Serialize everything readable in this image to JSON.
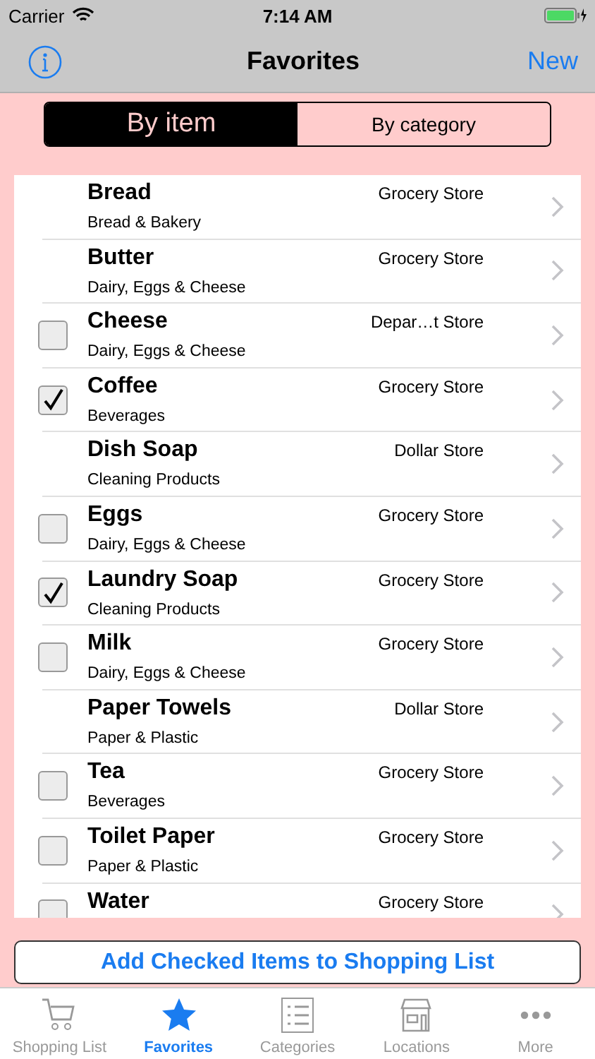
{
  "status_bar": {
    "carrier": "Carrier",
    "time": "7:14 AM"
  },
  "nav": {
    "title": "Favorites",
    "right_button": "New"
  },
  "segments": [
    {
      "label": "By item",
      "selected": true
    },
    {
      "label": "By category",
      "selected": false
    }
  ],
  "items": [
    {
      "name": "Bread",
      "category": "Bread & Bakery",
      "store": "Grocery Store",
      "kind": "plain"
    },
    {
      "name": "Butter",
      "category": "Dairy, Eggs & Cheese",
      "store": "Grocery Store",
      "kind": "plain"
    },
    {
      "name": "Cheese",
      "category": "Dairy, Eggs & Cheese",
      "store": "Depar…t Store",
      "kind": "checkable",
      "checked": false
    },
    {
      "name": "Coffee",
      "category": "Beverages",
      "store": "Grocery Store",
      "kind": "checkable",
      "checked": true
    },
    {
      "name": "Dish Soap",
      "category": "Cleaning Products",
      "store": "Dollar Store",
      "kind": "plain"
    },
    {
      "name": "Eggs",
      "category": "Dairy, Eggs & Cheese",
      "store": "Grocery Store",
      "kind": "checkable",
      "checked": false
    },
    {
      "name": "Laundry Soap",
      "category": "Cleaning Products",
      "store": "Grocery Store",
      "kind": "checkable",
      "checked": true
    },
    {
      "name": "Milk",
      "category": "Dairy, Eggs & Cheese",
      "store": "Grocery Store",
      "kind": "checkable",
      "checked": false
    },
    {
      "name": "Paper Towels",
      "category": "Paper & Plastic",
      "store": "Dollar Store",
      "kind": "plain"
    },
    {
      "name": "Tea",
      "category": "Beverages",
      "store": "Grocery Store",
      "kind": "checkable",
      "checked": false
    },
    {
      "name": "Toilet Paper",
      "category": "Paper & Plastic",
      "store": "Grocery Store",
      "kind": "checkable",
      "checked": false
    },
    {
      "name": "Water",
      "store": "Grocery Store",
      "kind": "checkable",
      "checked": false
    }
  ],
  "action_button": "Add Checked Items to Shopping List",
  "tabs": [
    {
      "label": "Shopping List",
      "selected": false
    },
    {
      "label": "Favorites",
      "selected": true
    },
    {
      "label": "Categories",
      "selected": false
    },
    {
      "label": "Locations",
      "selected": false
    },
    {
      "label": "More",
      "selected": false
    }
  ]
}
